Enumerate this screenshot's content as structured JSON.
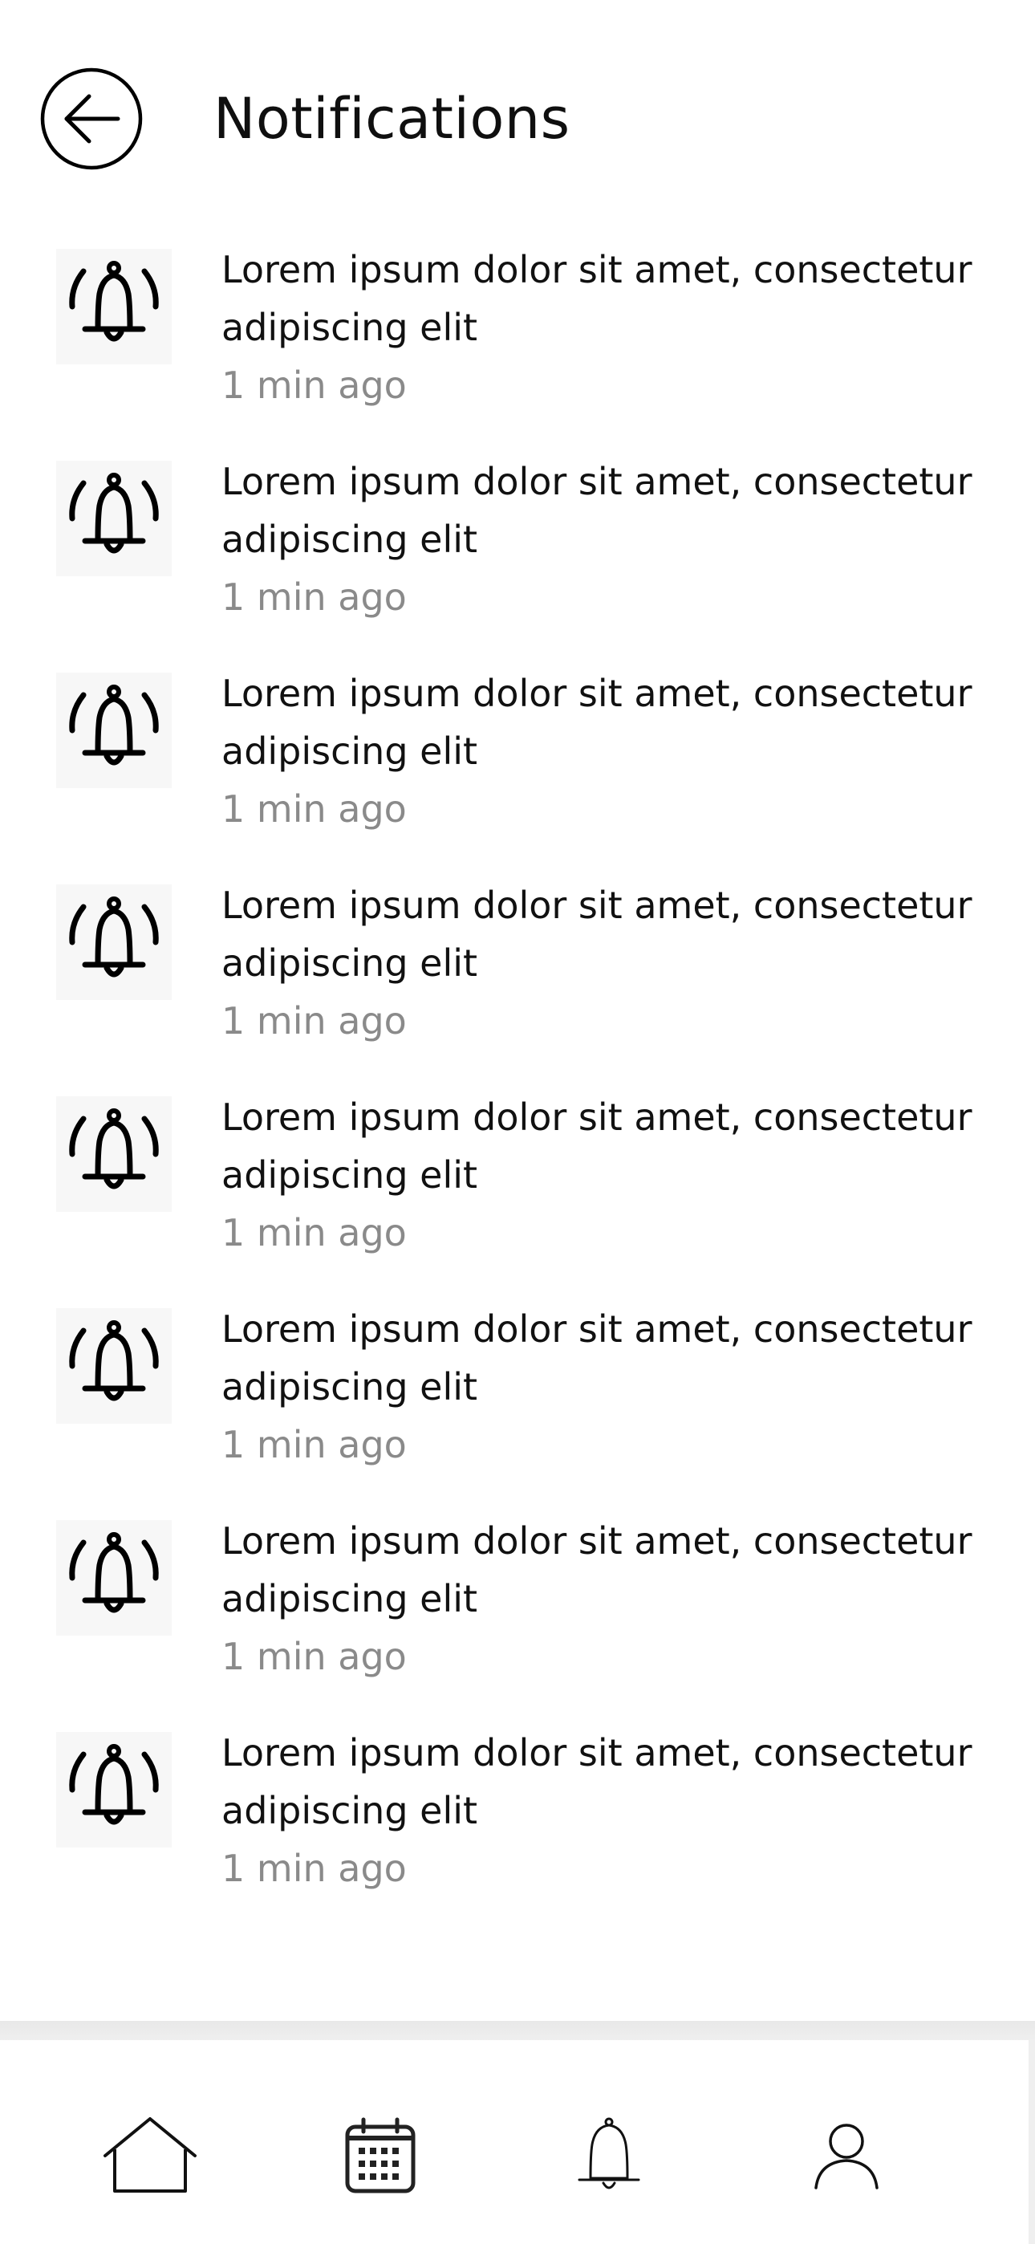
{
  "header": {
    "title": "Notifications",
    "back_icon": "arrow-left-circle-icon"
  },
  "notifications": [
    {
      "message": "Lorem ipsum dolor sit amet, consectetur adipiscing elit",
      "time": "1 min ago",
      "icon": "bell-ringing-icon"
    },
    {
      "message": "Lorem ipsum dolor sit amet, consectetur adipiscing elit",
      "time": "1 min ago",
      "icon": "bell-ringing-icon"
    },
    {
      "message": "Lorem ipsum dolor sit amet, consectetur adipiscing elit",
      "time": "1 min ago",
      "icon": "bell-ringing-icon"
    },
    {
      "message": "Lorem ipsum dolor sit amet, consectetur adipiscing elit",
      "time": "1 min ago",
      "icon": "bell-ringing-icon"
    },
    {
      "message": "Lorem ipsum dolor sit amet, consectetur adipiscing elit",
      "time": "1 min ago",
      "icon": "bell-ringing-icon"
    },
    {
      "message": "Lorem ipsum dolor sit amet, consectetur adipiscing elit",
      "time": "1 min ago",
      "icon": "bell-ringing-icon"
    },
    {
      "message": "Lorem ipsum dolor sit amet, consectetur adipiscing elit",
      "time": "1 min ago",
      "icon": "bell-ringing-icon"
    },
    {
      "message": "Lorem ipsum dolor sit amet, consectetur adipiscing elit",
      "time": "1 min ago",
      "icon": "bell-ringing-icon"
    }
  ],
  "bottom_nav": [
    {
      "icon": "home-icon"
    },
    {
      "icon": "calendar-icon"
    },
    {
      "icon": "bell-icon"
    },
    {
      "icon": "user-icon"
    }
  ],
  "colors": {
    "text": "#111111",
    "muted_text": "#8a8a8a",
    "icon_stroke": "#000000",
    "background": "#ffffff"
  }
}
